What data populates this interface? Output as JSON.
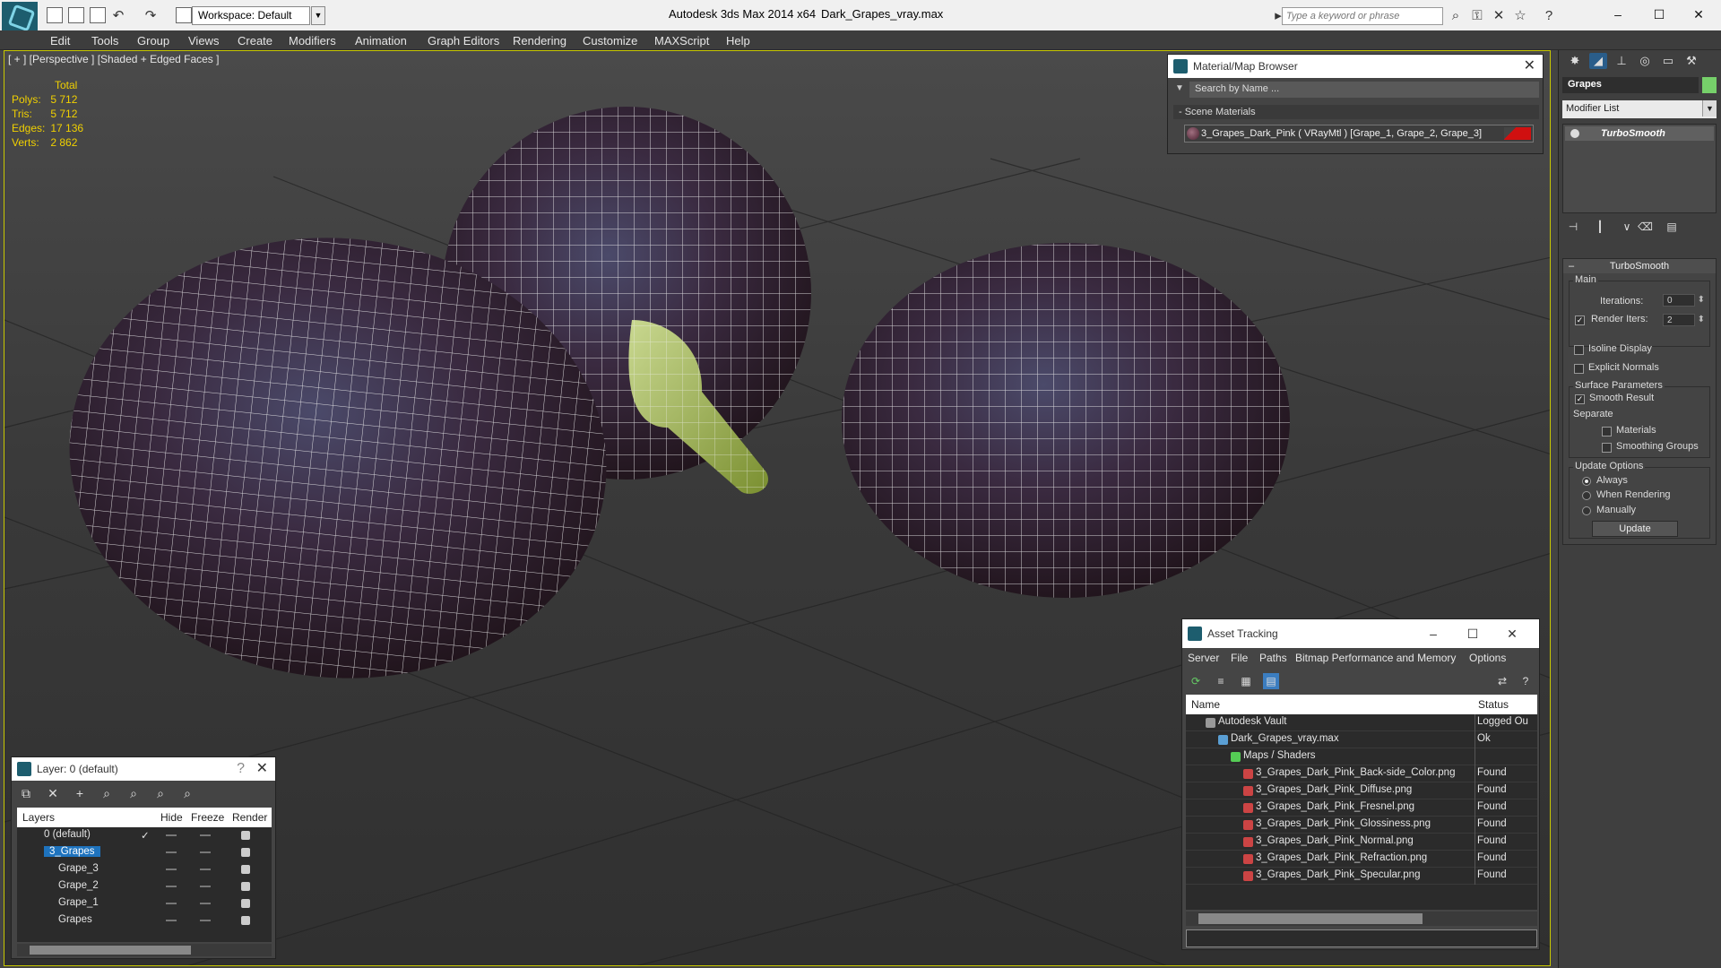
{
  "titlebar": {
    "workspace": "Workspace: Default",
    "app_title": "Autodesk 3ds Max  2014 x64",
    "file_title": "Dark_Grapes_vray.max",
    "search_placeholder": "Type a keyword or phrase"
  },
  "menu": [
    "Edit",
    "Tools",
    "Group",
    "Views",
    "Create",
    "Modifiers",
    "Animation",
    "Graph Editors",
    "Rendering",
    "Customize",
    "MAXScript",
    "Help"
  ],
  "viewport": {
    "label": "[ + ] [Perspective ] [Shaded + Edged Faces ]",
    "stats_header": "Total",
    "stats": [
      {
        "k": "Polys:",
        "v": "5 712"
      },
      {
        "k": "Tris:",
        "v": "5 712"
      },
      {
        "k": "Edges:",
        "v": "17 136"
      },
      {
        "k": "Verts:",
        "v": "2 862"
      }
    ]
  },
  "material_browser": {
    "title": "Material/Map Browser",
    "search": "Search by Name ...",
    "section": "- Scene Materials",
    "item": "3_Grapes_Dark_Pink  ( VRayMtl )  [Grape_1, Grape_2, Grape_3]"
  },
  "command_panel": {
    "object_name": "Grapes",
    "modifier_list": "Modifier List",
    "stack_item": "TurboSmooth",
    "rollout_title": "TurboSmooth",
    "main_label": "Main",
    "iterations_label": "Iterations:",
    "iterations": "0",
    "render_iters_label": "Render Iters:",
    "render_iters": "2",
    "isoline": "Isoline Display",
    "explicit_normals": "Explicit Normals",
    "surface_params": "Surface Parameters",
    "smooth_result": "Smooth Result",
    "separate": "Separate",
    "materials": "Materials",
    "smoothing_groups": "Smoothing Groups",
    "update_options": "Update Options",
    "always": "Always",
    "when_rendering": "When Rendering",
    "manually": "Manually",
    "update_button": "Update"
  },
  "asset_tracking": {
    "title": "Asset Tracking",
    "menu": [
      "Server",
      "File",
      "Paths",
      "Bitmap Performance and Memory",
      "Options"
    ],
    "col_name": "Name",
    "col_status": "Status",
    "rows": [
      {
        "name": "Autodesk Vault",
        "status": "Logged Ou"
      },
      {
        "name": "Dark_Grapes_vray.max",
        "status": "Ok"
      },
      {
        "name": "Maps / Shaders",
        "status": ""
      },
      {
        "name": "3_Grapes_Dark_Pink_Back-side_Color.png",
        "status": "Found"
      },
      {
        "name": "3_Grapes_Dark_Pink_Diffuse.png",
        "status": "Found"
      },
      {
        "name": "3_Grapes_Dark_Pink_Fresnel.png",
        "status": "Found"
      },
      {
        "name": "3_Grapes_Dark_Pink_Glossiness.png",
        "status": "Found"
      },
      {
        "name": "3_Grapes_Dark_Pink_Normal.png",
        "status": "Found"
      },
      {
        "name": "3_Grapes_Dark_Pink_Refraction.png",
        "status": "Found"
      },
      {
        "name": "3_Grapes_Dark_Pink_Specular.png",
        "status": "Found"
      }
    ]
  },
  "layers": {
    "title": "Layer: 0 (default)",
    "col_layers": "Layers",
    "col_hide": "Hide",
    "col_freeze": "Freeze",
    "col_render": "Render",
    "rows": [
      {
        "name": "0 (default)"
      },
      {
        "name": "3_Grapes"
      },
      {
        "name": "Grape_3"
      },
      {
        "name": "Grape_2"
      },
      {
        "name": "Grape_1"
      },
      {
        "name": "Grapes"
      }
    ]
  }
}
